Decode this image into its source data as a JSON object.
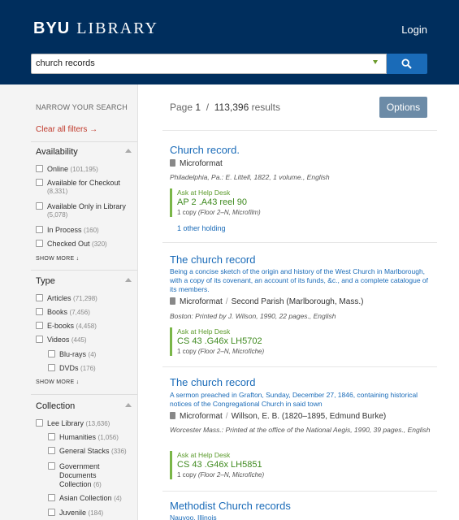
{
  "header": {
    "logo_byu": "BYU",
    "logo_library": "LIBRARY",
    "login": "Login"
  },
  "search": {
    "value": "church records"
  },
  "sidebar": {
    "narrow": "NARROW YOUR SEARCH",
    "clear": "Clear all filters →",
    "availability": {
      "title": "Availability",
      "items": [
        {
          "label": "Online",
          "count": "(101,195)"
        },
        {
          "label": "Available for Checkout",
          "count": "(8,331)"
        },
        {
          "label": "Available Only in Library",
          "count": "(5,078)"
        },
        {
          "label": "In Process",
          "count": "(160)"
        },
        {
          "label": "Checked Out",
          "count": "(320)"
        }
      ],
      "show_more": "SHOW MORE ↓"
    },
    "type": {
      "title": "Type",
      "items": [
        {
          "label": "Articles",
          "count": "(71,298)"
        },
        {
          "label": "Books",
          "count": "(7,456)"
        },
        {
          "label": "E-books",
          "count": "(4,458)"
        },
        {
          "label": "Videos",
          "count": "(445)"
        },
        {
          "label": "Blu-rays",
          "count": "(4)"
        },
        {
          "label": "DVDs",
          "count": "(176)"
        }
      ],
      "show_more": "SHOW MORE ↓"
    },
    "collection": {
      "title": "Collection",
      "items": [
        {
          "label": "Lee Library",
          "count": "(13,636)"
        },
        {
          "label": "Humanities",
          "count": "(1,056)"
        },
        {
          "label": "General Stacks",
          "count": "(336)"
        },
        {
          "label": "Government",
          "label2": "Documents",
          "label3": "Collection",
          "count": "(6)"
        },
        {
          "label": "Asian Collection",
          "count": "(4)"
        },
        {
          "label": "Juvenile",
          "count": "(184)"
        }
      ]
    }
  },
  "results": {
    "page_label": "Page",
    "page": "1",
    "slash": "/",
    "total": "113,396",
    "results_label": "results",
    "options": "Options",
    "items": [
      {
        "title": "Church record.",
        "format": "Microformat",
        "pub": "Philadelphia, Pa.: E. Littell, 1822, 1 volume., English",
        "ask": "Ask at Help Desk",
        "call": "AP 2 .A43 reel 90",
        "copy": "1 copy",
        "loc": "(Floor 2–N, Microfilm)",
        "other": "1 other holding"
      },
      {
        "title": "The church record",
        "subtitle": "Being a concise sketch of the origin and history of the West Church in Marlborough, with a copy of its covenant, an account of its funds, &c., and a complete catalogue of its members.",
        "format": "Microformat",
        "author": "Second Parish (Marlborough, Mass.)",
        "pub": "Boston: Printed by J. Wilson, 1990, 22 pages., English",
        "ask": "Ask at Help Desk",
        "call": "CS 43 .G46x LH5702",
        "copy": "1 copy",
        "loc": "(Floor 2–N, Microfiche)"
      },
      {
        "title": "The church record",
        "subtitle": "A sermon preached in Grafton, Sunday, December 27, 1846, containing historical notices of the Congregational Church in said town",
        "format": "Microformat",
        "author": "Willson, E. B. (1820–1895, Edmund Burke)",
        "pub": "Worcester Mass.: Printed at the office of the National Aegis, 1990, 39 pages., English",
        "ask": "Ask at Help Desk",
        "call": "CS 43 .G46x LH5851",
        "copy": "1 copy",
        "loc": "(Floor 2–N, Microfiche)"
      },
      {
        "title": "Methodist Church records",
        "subtitle": "Nauvoo, Illinois"
      }
    ]
  },
  "colors": {
    "header": "#002e5d",
    "link": "#1a6bb8",
    "holding": "#3f8a1f",
    "options": "#6c8ba7"
  }
}
